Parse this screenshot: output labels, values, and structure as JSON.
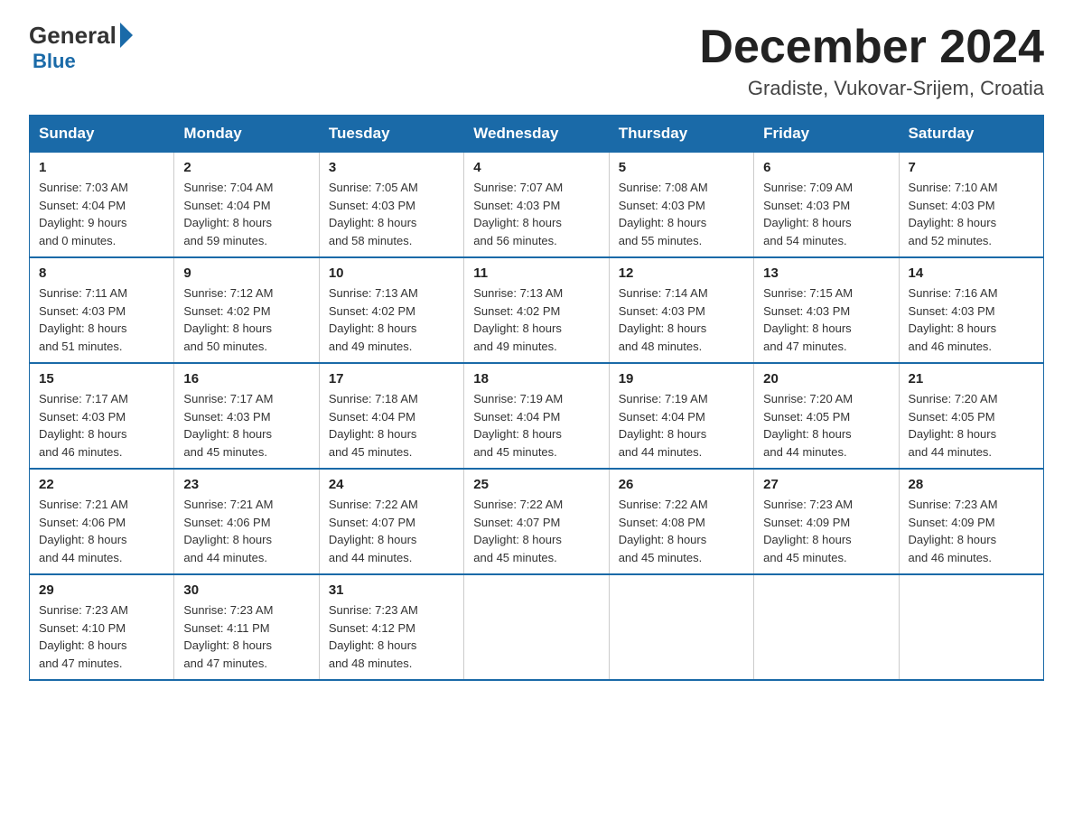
{
  "header": {
    "logo_general": "General",
    "logo_blue": "Blue",
    "title": "December 2024",
    "subtitle": "Gradiste, Vukovar-Srijem, Croatia"
  },
  "weekdays": [
    "Sunday",
    "Monday",
    "Tuesday",
    "Wednesday",
    "Thursday",
    "Friday",
    "Saturday"
  ],
  "weeks": [
    [
      {
        "day": "1",
        "sunrise": "7:03 AM",
        "sunset": "4:04 PM",
        "daylight": "9 hours and 0 minutes."
      },
      {
        "day": "2",
        "sunrise": "7:04 AM",
        "sunset": "4:04 PM",
        "daylight": "8 hours and 59 minutes."
      },
      {
        "day": "3",
        "sunrise": "7:05 AM",
        "sunset": "4:03 PM",
        "daylight": "8 hours and 58 minutes."
      },
      {
        "day": "4",
        "sunrise": "7:07 AM",
        "sunset": "4:03 PM",
        "daylight": "8 hours and 56 minutes."
      },
      {
        "day": "5",
        "sunrise": "7:08 AM",
        "sunset": "4:03 PM",
        "daylight": "8 hours and 55 minutes."
      },
      {
        "day": "6",
        "sunrise": "7:09 AM",
        "sunset": "4:03 PM",
        "daylight": "8 hours and 54 minutes."
      },
      {
        "day": "7",
        "sunrise": "7:10 AM",
        "sunset": "4:03 PM",
        "daylight": "8 hours and 52 minutes."
      }
    ],
    [
      {
        "day": "8",
        "sunrise": "7:11 AM",
        "sunset": "4:03 PM",
        "daylight": "8 hours and 51 minutes."
      },
      {
        "day": "9",
        "sunrise": "7:12 AM",
        "sunset": "4:02 PM",
        "daylight": "8 hours and 50 minutes."
      },
      {
        "day": "10",
        "sunrise": "7:13 AM",
        "sunset": "4:02 PM",
        "daylight": "8 hours and 49 minutes."
      },
      {
        "day": "11",
        "sunrise": "7:13 AM",
        "sunset": "4:02 PM",
        "daylight": "8 hours and 49 minutes."
      },
      {
        "day": "12",
        "sunrise": "7:14 AM",
        "sunset": "4:03 PM",
        "daylight": "8 hours and 48 minutes."
      },
      {
        "day": "13",
        "sunrise": "7:15 AM",
        "sunset": "4:03 PM",
        "daylight": "8 hours and 47 minutes."
      },
      {
        "day": "14",
        "sunrise": "7:16 AM",
        "sunset": "4:03 PM",
        "daylight": "8 hours and 46 minutes."
      }
    ],
    [
      {
        "day": "15",
        "sunrise": "7:17 AM",
        "sunset": "4:03 PM",
        "daylight": "8 hours and 46 minutes."
      },
      {
        "day": "16",
        "sunrise": "7:17 AM",
        "sunset": "4:03 PM",
        "daylight": "8 hours and 45 minutes."
      },
      {
        "day": "17",
        "sunrise": "7:18 AM",
        "sunset": "4:04 PM",
        "daylight": "8 hours and 45 minutes."
      },
      {
        "day": "18",
        "sunrise": "7:19 AM",
        "sunset": "4:04 PM",
        "daylight": "8 hours and 45 minutes."
      },
      {
        "day": "19",
        "sunrise": "7:19 AM",
        "sunset": "4:04 PM",
        "daylight": "8 hours and 44 minutes."
      },
      {
        "day": "20",
        "sunrise": "7:20 AM",
        "sunset": "4:05 PM",
        "daylight": "8 hours and 44 minutes."
      },
      {
        "day": "21",
        "sunrise": "7:20 AM",
        "sunset": "4:05 PM",
        "daylight": "8 hours and 44 minutes."
      }
    ],
    [
      {
        "day": "22",
        "sunrise": "7:21 AM",
        "sunset": "4:06 PM",
        "daylight": "8 hours and 44 minutes."
      },
      {
        "day": "23",
        "sunrise": "7:21 AM",
        "sunset": "4:06 PM",
        "daylight": "8 hours and 44 minutes."
      },
      {
        "day": "24",
        "sunrise": "7:22 AM",
        "sunset": "4:07 PM",
        "daylight": "8 hours and 44 minutes."
      },
      {
        "day": "25",
        "sunrise": "7:22 AM",
        "sunset": "4:07 PM",
        "daylight": "8 hours and 45 minutes."
      },
      {
        "day": "26",
        "sunrise": "7:22 AM",
        "sunset": "4:08 PM",
        "daylight": "8 hours and 45 minutes."
      },
      {
        "day": "27",
        "sunrise": "7:23 AM",
        "sunset": "4:09 PM",
        "daylight": "8 hours and 45 minutes."
      },
      {
        "day": "28",
        "sunrise": "7:23 AM",
        "sunset": "4:09 PM",
        "daylight": "8 hours and 46 minutes."
      }
    ],
    [
      {
        "day": "29",
        "sunrise": "7:23 AM",
        "sunset": "4:10 PM",
        "daylight": "8 hours and 47 minutes."
      },
      {
        "day": "30",
        "sunrise": "7:23 AM",
        "sunset": "4:11 PM",
        "daylight": "8 hours and 47 minutes."
      },
      {
        "day": "31",
        "sunrise": "7:23 AM",
        "sunset": "4:12 PM",
        "daylight": "8 hours and 48 minutes."
      },
      null,
      null,
      null,
      null
    ]
  ]
}
